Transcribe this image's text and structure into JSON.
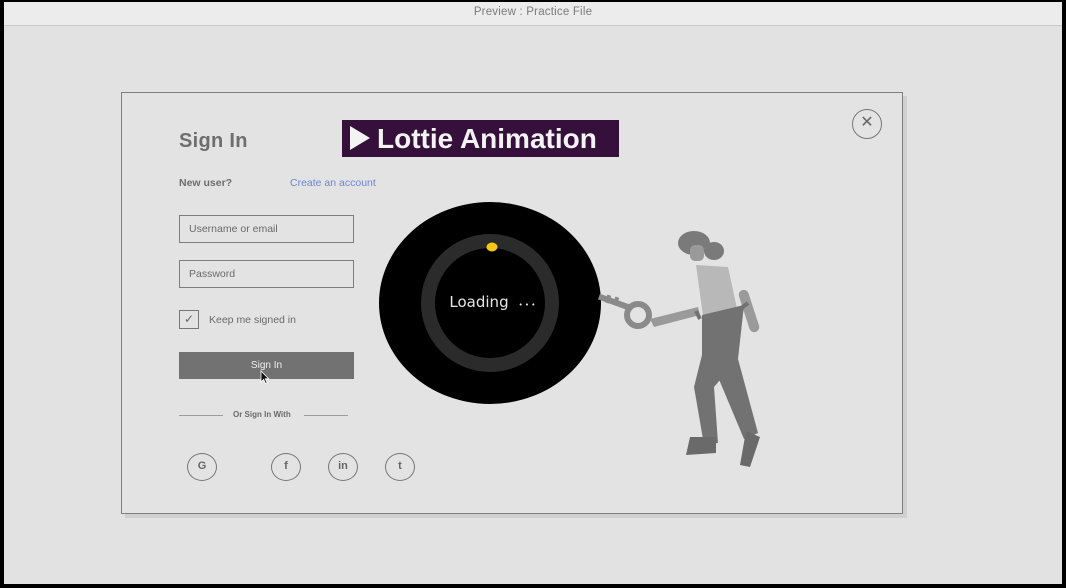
{
  "window": {
    "title": "Preview : Practice File"
  },
  "form": {
    "title": "Sign In",
    "new_user": "New user?",
    "create_account": "Create an account",
    "username_placeholder": "Username or email",
    "password_placeholder": "Password",
    "keep_signed_in": "Keep me signed in",
    "submit_label": "Sign In",
    "or_sign_in_with": "Or Sign In With"
  },
  "badge": {
    "label": "Lottie Animation"
  },
  "close": {
    "icon": "close-icon",
    "glyph": "✕"
  },
  "checkbox": {
    "checked": true,
    "glyph": "✓"
  },
  "loader": {
    "text": "Loading",
    "dots": "• • •"
  },
  "social": [
    {
      "name": "google",
      "icon": "google-icon",
      "glyph": "G"
    },
    {
      "name": "facebook",
      "icon": "facebook-icon",
      "glyph": "f"
    },
    {
      "name": "linkedin",
      "icon": "linkedin-icon",
      "glyph": "in"
    },
    {
      "name": "twitter",
      "icon": "twitter-icon",
      "glyph": "t"
    }
  ],
  "colors": {
    "badge_bg": "#34103a",
    "link": "#6d86d6",
    "button": "#727272",
    "loader_dot": "#f5c518"
  }
}
